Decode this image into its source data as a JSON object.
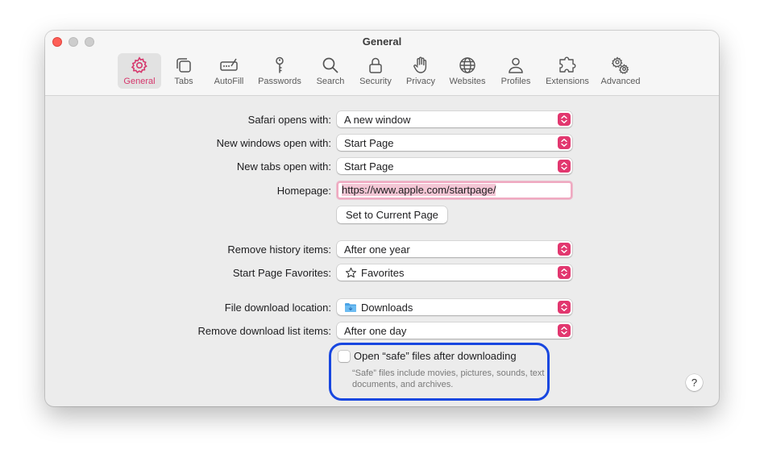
{
  "window": {
    "title": "General"
  },
  "toolbar": {
    "items": [
      {
        "label": "General",
        "icon": "gear-icon",
        "active": true
      },
      {
        "label": "Tabs",
        "icon": "tabs-icon"
      },
      {
        "label": "AutoFill",
        "icon": "autofill-icon"
      },
      {
        "label": "Passwords",
        "icon": "key-icon"
      },
      {
        "label": "Search",
        "icon": "search-icon"
      },
      {
        "label": "Security",
        "icon": "lock-icon"
      },
      {
        "label": "Privacy",
        "icon": "hand-icon"
      },
      {
        "label": "Websites",
        "icon": "globe-icon"
      },
      {
        "label": "Profiles",
        "icon": "person-icon"
      },
      {
        "label": "Extensions",
        "icon": "puzzle-icon"
      },
      {
        "label": "Advanced",
        "icon": "gears-icon"
      }
    ]
  },
  "settings": {
    "safari_opens_with": {
      "label": "Safari opens with:",
      "value": "A new window"
    },
    "new_windows": {
      "label": "New windows open with:",
      "value": "Start Page"
    },
    "new_tabs": {
      "label": "New tabs open with:",
      "value": "Start Page"
    },
    "homepage": {
      "label": "Homepage:",
      "value": "https://www.apple.com/startpage/"
    },
    "set_current_button": "Set to Current Page",
    "remove_history": {
      "label": "Remove history items:",
      "value": "After one year"
    },
    "start_page_favorites": {
      "label": "Start Page Favorites:",
      "value": "Favorites"
    },
    "download_location": {
      "label": "File download location:",
      "value": "Downloads"
    },
    "remove_download": {
      "label": "Remove download list items:",
      "value": "After one day"
    },
    "open_safe_files": {
      "label": "Open “safe” files after downloading",
      "checked": false,
      "help": "“Safe” files include movies, pictures, sounds, text documents, and archives."
    }
  },
  "help_button": "?",
  "colors": {
    "accent": "#e2376f",
    "highlight_ring": "#1847e0"
  }
}
